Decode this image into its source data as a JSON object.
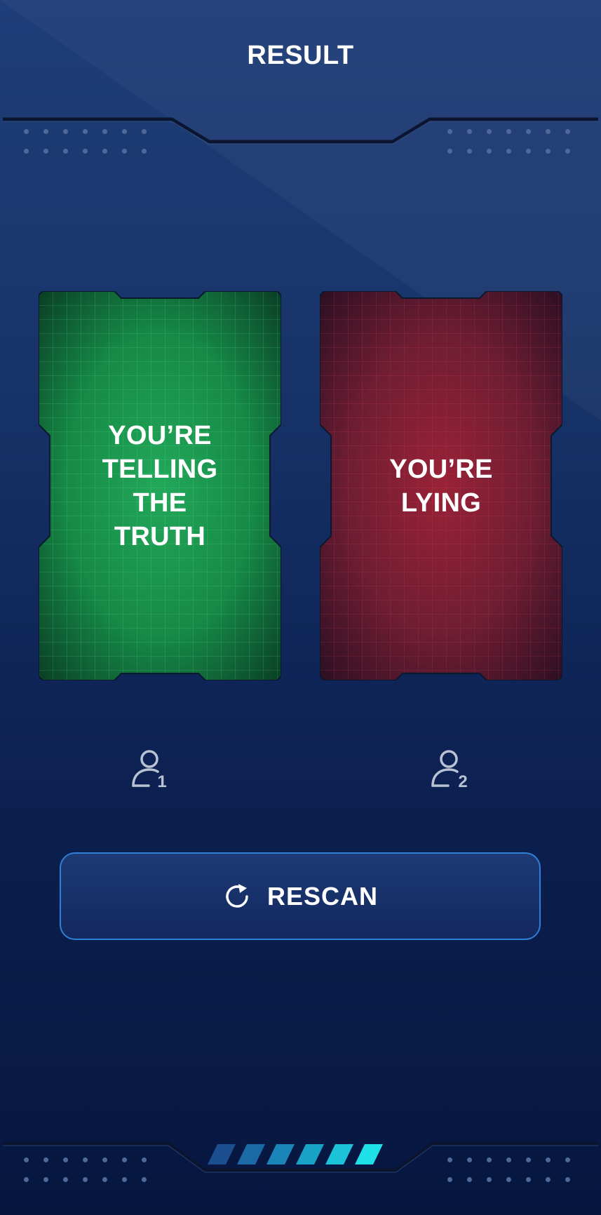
{
  "header": {
    "title": "RESULT"
  },
  "cards": [
    {
      "text": "YOU’RE\nTELLING\nTHE\nTRUTH",
      "color": "#1f9e54"
    },
    {
      "text": "YOU’RE\nLYING",
      "color": "#8a2338"
    }
  ],
  "players": [
    {
      "number": "1",
      "icon": "user-icon"
    },
    {
      "number": "2",
      "icon": "user-icon"
    }
  ],
  "rescan": {
    "label": "RESCAN",
    "icon": "refresh-icon"
  },
  "colors": {
    "background_top": "#1f3d78",
    "background_bottom": "#06163f",
    "button_border": "#2f7fd6",
    "accent_cyan": "#1ee0e6"
  }
}
